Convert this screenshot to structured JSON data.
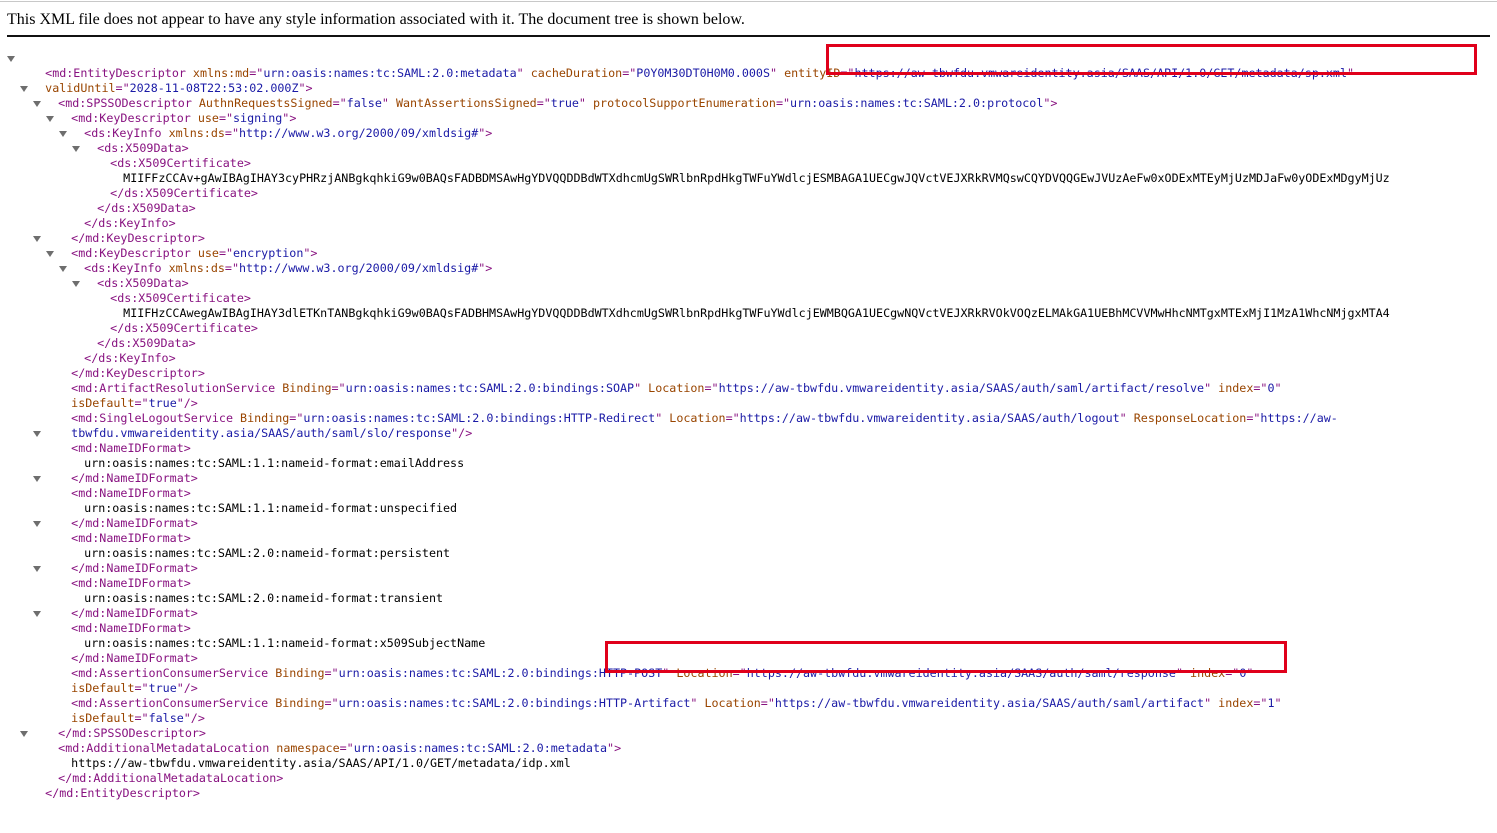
{
  "banner": "This XML file does not appear to have any style information associated with it. The document tree is shown below.",
  "xml": {
    "l01": {
      "a": "<md:EntityDescriptor",
      "b": " xmlns:md",
      "c": "=\"",
      "d": "urn:oasis:names:tc:SAML:2.0:metadata",
      "e": "\"",
      "f": " cacheDuration",
      "g": "=\"",
      "h": "P0Y0M30DT0H0M0.000S",
      "i": "\"",
      "j": " entityID",
      "k": "=\"",
      "l": "https://aw-tbwfdu.vmwareidentity.asia/SAAS/API/1.0/GET/metadata/sp.xml",
      "m": "\""
    },
    "l02": {
      "a": "validUntil",
      "b": "=\"",
      "c": "2028-11-08T22:53:02.000Z",
      "d": "\">"
    },
    "l03": {
      "a": "<md:SPSSODescriptor",
      "b": " AuthnRequestsSigned",
      "c": "=\"",
      "d": "false",
      "e": "\"",
      "f": " WantAssertionsSigned",
      "g": "=\"",
      "h": "true",
      "i": "\"",
      "j": " protocolSupportEnumeration",
      "k": "=\"",
      "l": "urn:oasis:names:tc:SAML:2.0:protocol",
      "m": "\">"
    },
    "l04": {
      "a": "<md:KeyDescriptor",
      "b": " use",
      "c": "=\"",
      "d": "signing",
      "e": "\">"
    },
    "l05": {
      "a": "<ds:KeyInfo",
      "b": " xmlns:ds",
      "c": "=\"",
      "d": "http://www.w3.org/2000/09/xmldsig#",
      "e": "\">"
    },
    "l06": {
      "a": "<ds:X509Data>"
    },
    "l07": {
      "a": "<ds:X509Certificate>"
    },
    "l08": {
      "a": "MIIFFzCCAv+gAwIBAgIHAY3cyPHRzjANBgkqhkiG9w0BAQsFADBDMSAwHgYDVQQDDBdWTXdhcmUgSWRlbnRpdHkgTWFuYWdlcjESMBAGA1UECgwJQVctVEJXRkRVMQswCQYDVQQGEwJVUzAeFw0xODExMTEyMjUzMDJaFw0yODExMDgyMjUz"
    },
    "l09": {
      "a": "</ds:X509Certificate>"
    },
    "l10": {
      "a": "</ds:X509Data>"
    },
    "l11": {
      "a": "</ds:KeyInfo>"
    },
    "l12": {
      "a": "</md:KeyDescriptor>"
    },
    "l13": {
      "a": "<md:KeyDescriptor",
      "b": " use",
      "c": "=\"",
      "d": "encryption",
      "e": "\">"
    },
    "l14": {
      "a": "<ds:KeyInfo",
      "b": " xmlns:ds",
      "c": "=\"",
      "d": "http://www.w3.org/2000/09/xmldsig#",
      "e": "\">"
    },
    "l15": {
      "a": "<ds:X509Data>"
    },
    "l16": {
      "a": "<ds:X509Certificate>"
    },
    "l17": {
      "a": "MIIFHzCCAwegAwIBAgIHAY3dlETKnTANBgkqhkiG9w0BAQsFADBHMSAwHgYDVQQDDBdWTXdhcmUgSWRlbnRpdHkgTWFuYWdlcjEWMBQGA1UECgwNQVctVEJXRkRVOkVOQzELMAkGA1UEBhMCVVMwHhcNMTgxMTExMjI1MzA1WhcNMjgxMTA4"
    },
    "l18": {
      "a": "</ds:X509Certificate>"
    },
    "l19": {
      "a": "</ds:X509Data>"
    },
    "l20": {
      "a": "</ds:KeyInfo>"
    },
    "l21": {
      "a": "</md:KeyDescriptor>"
    },
    "l22": {
      "a": "<md:ArtifactResolutionService",
      "b": " Binding",
      "c": "=\"",
      "d": "urn:oasis:names:tc:SAML:2.0:bindings:SOAP",
      "e": "\"",
      "f": " Location",
      "g": "=\"",
      "h": "https://aw-tbwfdu.vmwareidentity.asia/SAAS/auth/saml/artifact/resolve",
      "i": "\"",
      "j": " index",
      "k": "=\"",
      "l": "0",
      "m": "\""
    },
    "l23": {
      "a": "isDefault",
      "b": "=\"",
      "c": "true",
      "d": "\"/>"
    },
    "l24": {
      "a": "<md:SingleLogoutService",
      "b": " Binding",
      "c": "=\"",
      "d": "urn:oasis:names:tc:SAML:2.0:bindings:HTTP-Redirect",
      "e": "\"",
      "f": " Location",
      "g": "=\"",
      "h": "https://aw-tbwfdu.vmwareidentity.asia/SAAS/auth/logout",
      "i": "\"",
      "j": " ResponseLocation",
      "k": "=\"",
      "l": "https://aw-"
    },
    "l25": {
      "a": "tbwfdu.vmwareidentity.asia/SAAS/auth/saml/slo/response",
      "b": "\"/>"
    },
    "l26": {
      "a": "<md:NameIDFormat>"
    },
    "l27": {
      "a": "urn:oasis:names:tc:SAML:1.1:nameid-format:emailAddress"
    },
    "l28": {
      "a": "</md:NameIDFormat>"
    },
    "l29": {
      "a": "<md:NameIDFormat>"
    },
    "l30": {
      "a": "urn:oasis:names:tc:SAML:1.1:nameid-format:unspecified"
    },
    "l31": {
      "a": "</md:NameIDFormat>"
    },
    "l32": {
      "a": "<md:NameIDFormat>"
    },
    "l33": {
      "a": "urn:oasis:names:tc:SAML:2.0:nameid-format:persistent"
    },
    "l34": {
      "a": "</md:NameIDFormat>"
    },
    "l35": {
      "a": "<md:NameIDFormat>"
    },
    "l36": {
      "a": "urn:oasis:names:tc:SAML:2.0:nameid-format:transient"
    },
    "l37": {
      "a": "</md:NameIDFormat>"
    },
    "l38": {
      "a": "<md:NameIDFormat>"
    },
    "l39": {
      "a": "urn:oasis:names:tc:SAML:1.1:nameid-format:x509SubjectName"
    },
    "l40": {
      "a": "</md:NameIDFormat>"
    },
    "l41": {
      "a": "<md:AssertionConsumerService",
      "b": " Binding",
      "c": "=\"",
      "d": "urn:oasis:names:tc:SAML:2.0:bindings:HTTP-POST",
      "e": "\"",
      "f": " Location",
      "g": "=\"",
      "h": "https://aw-tbwfdu.vmwareidentity.asia/SAAS/auth/saml/response",
      "i": "\"",
      "j": " index",
      "k": "=\"",
      "l": "0",
      "m": "\""
    },
    "l42": {
      "a": "isDefault",
      "b": "=\"",
      "c": "true",
      "d": "\"/>"
    },
    "l43": {
      "a": "<md:AssertionConsumerService",
      "b": " Binding",
      "c": "=\"",
      "d": "urn:oasis:names:tc:SAML:2.0:bindings:HTTP-Artifact",
      "e": "\"",
      "f": " Location",
      "g": "=\"",
      "h": "https://aw-tbwfdu.vmwareidentity.asia/SAAS/auth/saml/artifact",
      "i": "\"",
      "j": " index",
      "k": "=\"",
      "l": "1",
      "m": "\""
    },
    "l44": {
      "a": "isDefault",
      "b": "=\"",
      "c": "false",
      "d": "\"/>"
    },
    "l45": {
      "a": "</md:SPSSODescriptor>"
    },
    "l46": {
      "a": "<md:AdditionalMetadataLocation",
      "b": " namespace",
      "c": "=\"",
      "d": "urn:oasis:names:tc:SAML:2.0:metadata",
      "e": "\">"
    },
    "l47": {
      "a": "https://aw-tbwfdu.vmwareidentity.asia/SAAS/API/1.0/GET/metadata/idp.xml"
    },
    "l48": {
      "a": "</md:AdditionalMetadataLocation>"
    },
    "l49": {
      "a": "</md:EntityDescriptor>"
    }
  },
  "colors": {
    "tag": "#881280",
    "attr_name": "#994500",
    "attr_value": "#1a1aa6",
    "highlight": "#e0001b"
  },
  "icons": {
    "expand": "triangle-down-icon"
  }
}
